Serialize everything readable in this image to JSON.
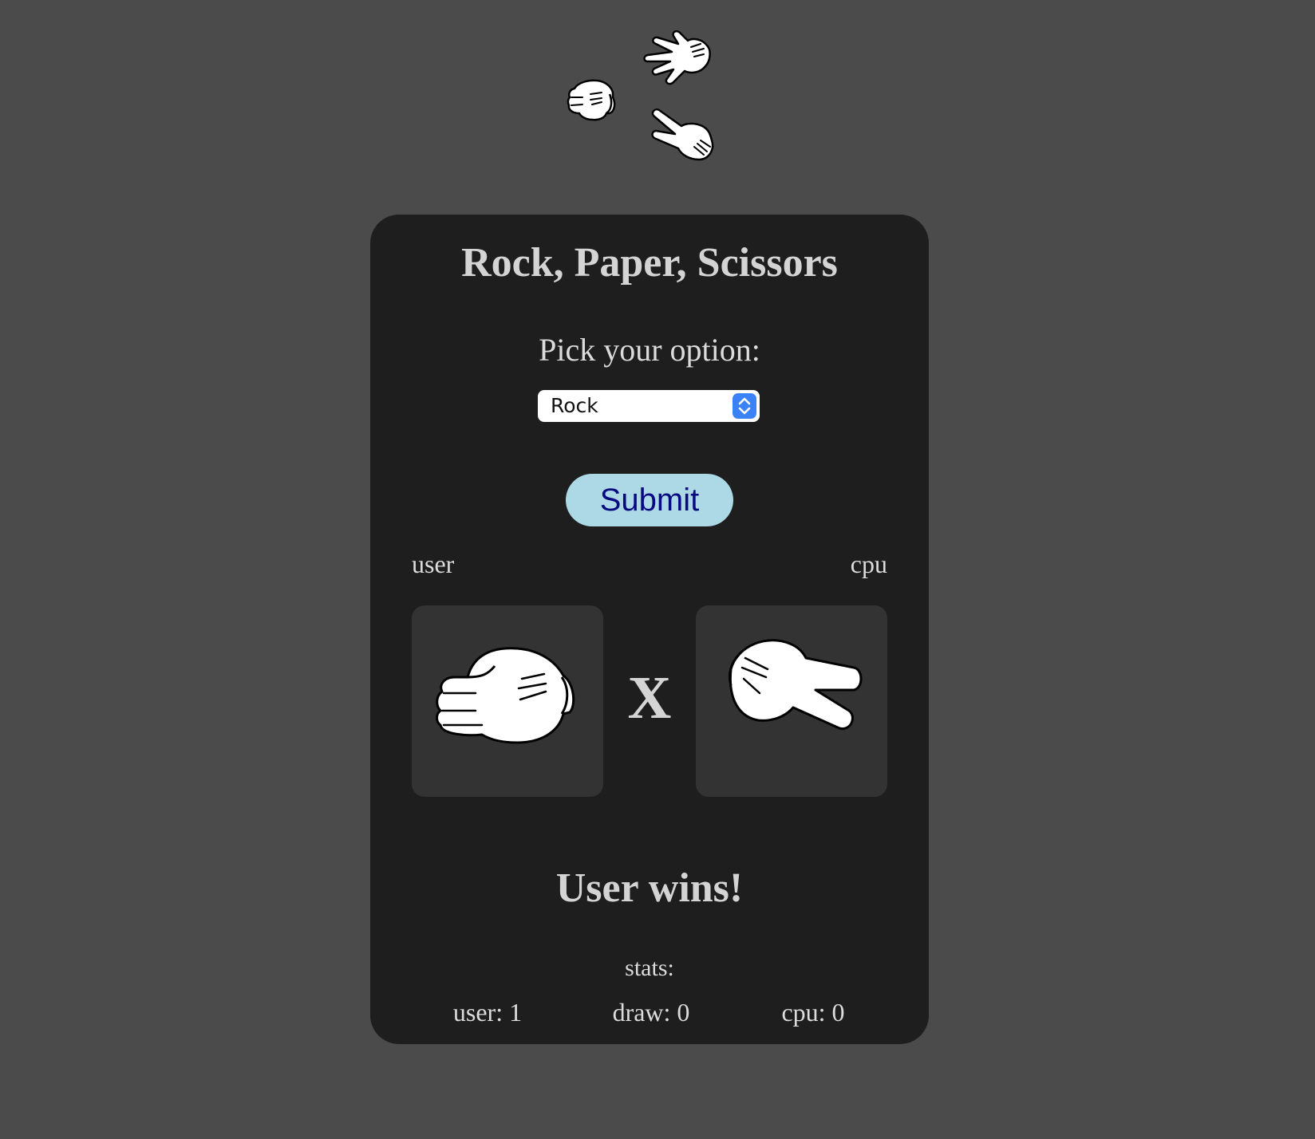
{
  "logo": {
    "icons": [
      "rock-hand-icon",
      "paper-hand-icon",
      "scissors-hand-icon"
    ]
  },
  "title": "Rock, Paper, Scissors",
  "picker": {
    "label": "Pick your option:",
    "selected": "Rock",
    "submit_label": "Submit"
  },
  "match": {
    "user_label": "user",
    "cpu_label": "cpu",
    "user_choice_icon": "rock-hand-icon",
    "cpu_choice_icon": "scissors-hand-icon",
    "versus": "X",
    "result": "User wins!"
  },
  "stats": {
    "label": "stats:",
    "user": "user: 1",
    "draw": "draw: 0",
    "cpu": "cpu: 0"
  },
  "colors": {
    "page_bg": "#4b4b4b",
    "card_bg": "#1e1e1e",
    "box_bg": "#333333",
    "submit_bg": "#add8e6",
    "submit_text": "#0a0a80",
    "select_accent": "#3b82f6"
  }
}
